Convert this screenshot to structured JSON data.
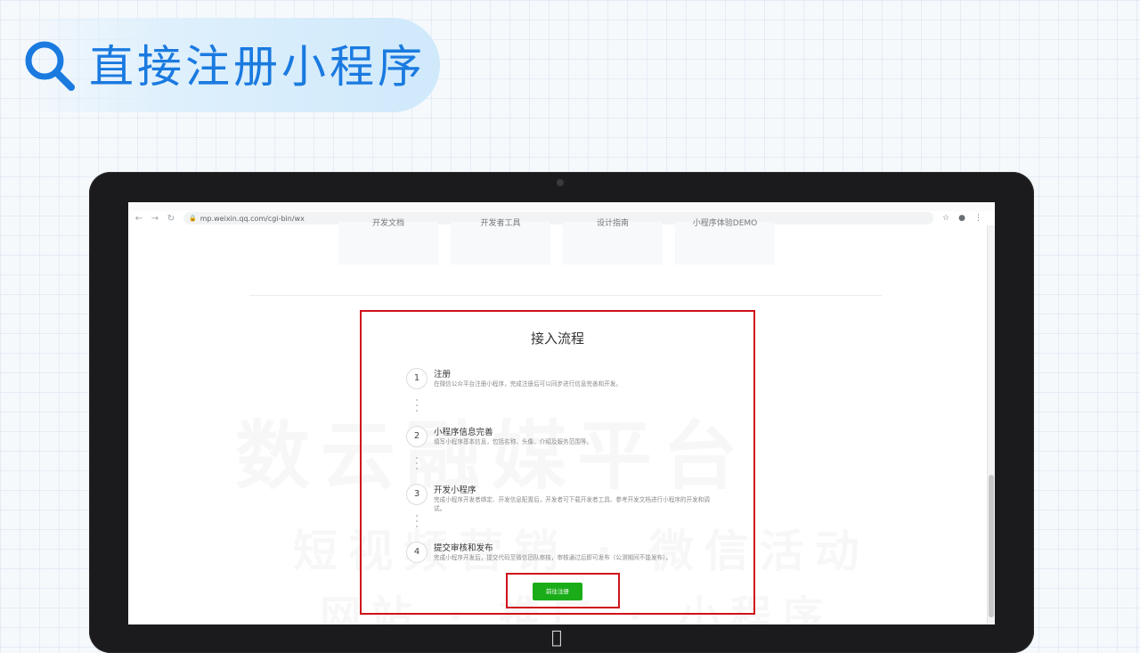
{
  "header": {
    "title": "直接注册小程序"
  },
  "browser": {
    "url": "mp.weixin.qq.com/cgi-bin/wx"
  },
  "page_nav": {
    "items": [
      "开发文档",
      "开发者工具",
      "设计指南",
      "小程序体验DEMO"
    ]
  },
  "watermark": {
    "line1": "数云融媒平台",
    "line2": "短视频营销 · 微信活动",
    "line3": "网站 · 推广 · 小程序"
  },
  "process": {
    "title": "接入流程",
    "steps": [
      {
        "num": "1",
        "title": "注册",
        "desc": "在微信公众平台注册小程序，完成注册后可以同步进行信息完善和开发。"
      },
      {
        "num": "2",
        "title": "小程序信息完善",
        "desc": "填写小程序基本信息，包括名称、头像、介绍及服务范围等。"
      },
      {
        "num": "3",
        "title": "开发小程序",
        "desc": "完成小程序开发者绑定、开发信息配置后，开发者可下载开发者工具、参考开发文档进行小程序的开发和调试。"
      },
      {
        "num": "4",
        "title": "提交审核和发布",
        "desc": "完成小程序开发后，提交代码至微信团队审核，审核通过后即可发布（公测期间不能发布）。"
      }
    ],
    "register_label": "前往注册"
  }
}
